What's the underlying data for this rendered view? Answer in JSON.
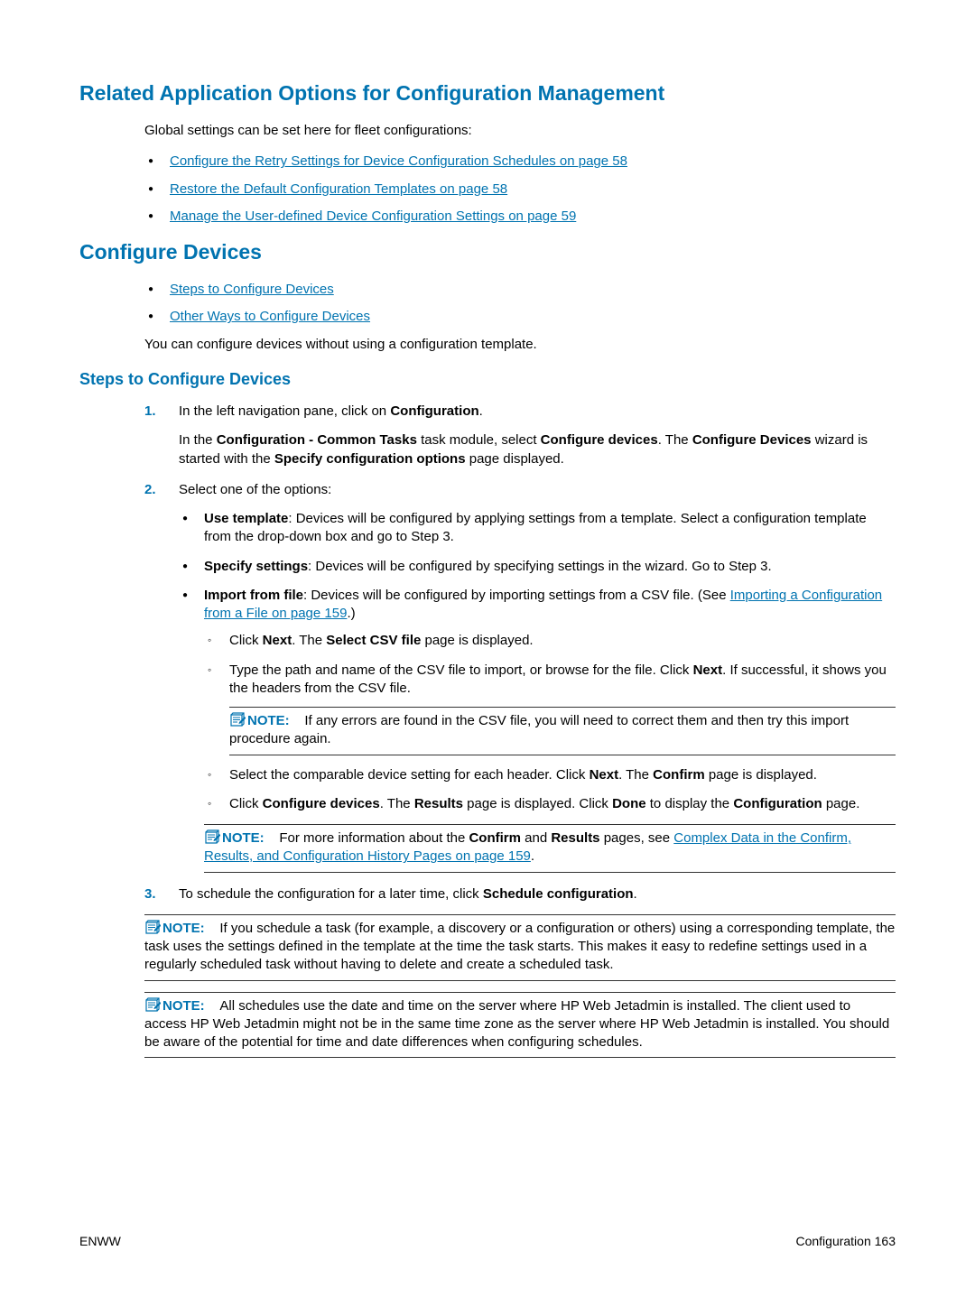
{
  "section1": {
    "heading": "Related Application Options for Configuration Management",
    "intro": "Global settings can be set here for fleet configurations:",
    "links": [
      "Configure the Retry Settings for Device Configuration Schedules on page 58",
      "Restore the Default Configuration Templates on page 58",
      "Manage the User-defined Device Configuration Settings on page 59"
    ]
  },
  "section2": {
    "heading": "Configure Devices",
    "links": [
      "Steps to Configure Devices",
      "Other Ways to Configure Devices"
    ],
    "para": "You can configure devices without using a configuration template."
  },
  "section3": {
    "heading": "Steps to Configure Devices",
    "step1": {
      "p1_a": "In the left navigation pane, click on ",
      "p1_b": "Configuration",
      "p1_c": ".",
      "p2_a": "In the ",
      "p2_b": "Configuration - Common Tasks",
      "p2_c": " task module, select ",
      "p2_d": "Configure devices",
      "p2_e": ". The ",
      "p2_f": "Configure Devices",
      "p2_g": " wizard is started with the ",
      "p2_h": "Specify configuration options",
      "p2_i": " page displayed."
    },
    "step2": {
      "p1": "Select one of the options:",
      "b1_a": "Use template",
      "b1_b": ": Devices will be configured by applying settings from a template. Select a configuration template from the drop-down box and go to Step 3.",
      "b2_a": "Specify settings",
      "b2_b": ": Devices will be configured by specifying settings in the wizard. Go to Step 3.",
      "b3_a": "Import from file",
      "b3_b": ": Devices will be configured by importing settings from a CSV file. (See ",
      "b3_link": "Importing a Configuration from a File on page 159",
      "b3_c": ".)",
      "c1_a": "Click ",
      "c1_b": "Next",
      "c1_c": ". The ",
      "c1_d": "Select CSV file",
      "c1_e": " page is displayed.",
      "c2_a": "Type the path and name of the CSV file to import, or browse for the file. Click ",
      "c2_b": "Next",
      "c2_c": ". If successful, it shows you the headers from the CSV file.",
      "note1_label": "NOTE:",
      "note1_body": "If any errors are found in the CSV file, you will need to correct them and then try this import procedure again.",
      "c3_a": "Select the comparable device setting for each header. Click ",
      "c3_b": "Next",
      "c3_c": ". The ",
      "c3_d": "Confirm",
      "c3_e": " page is displayed.",
      "c4_a": "Click ",
      "c4_b": "Configure devices",
      "c4_c": ". The ",
      "c4_d": "Results",
      "c4_e": " page is displayed. Click ",
      "c4_f": "Done",
      "c4_g": " to display the ",
      "c4_h": "Configuration",
      "c4_i": " page.",
      "note2_label": "NOTE:",
      "note2_a": "For more information about the ",
      "note2_b": "Confirm",
      "note2_c": " and ",
      "note2_d": "Results",
      "note2_e": " pages, see ",
      "note2_link": "Complex Data in the Confirm, Results, and Configuration History Pages on page 159",
      "note2_f": "."
    },
    "step3": {
      "p1_a": "To schedule the configuration for a later time, click ",
      "p1_b": "Schedule configuration",
      "p1_c": ".",
      "note3_label": "NOTE:",
      "note3_body": "If you schedule a task (for example, a discovery or a configuration or others) using a corresponding template, the task uses the settings defined in the template at the time the task starts. This makes it easy to redefine settings used in a regularly scheduled task without having to delete and create a scheduled task.",
      "note4_label": "NOTE:",
      "note4_body": "All schedules use the date and time on the server where HP Web Jetadmin is installed. The client used to access HP Web Jetadmin might not be in the same time zone as the server where HP Web Jetadmin is installed. You should be aware of the potential for time and date differences when configuring schedules."
    }
  },
  "footer": {
    "left": "ENWW",
    "right": "Configuration   163"
  }
}
